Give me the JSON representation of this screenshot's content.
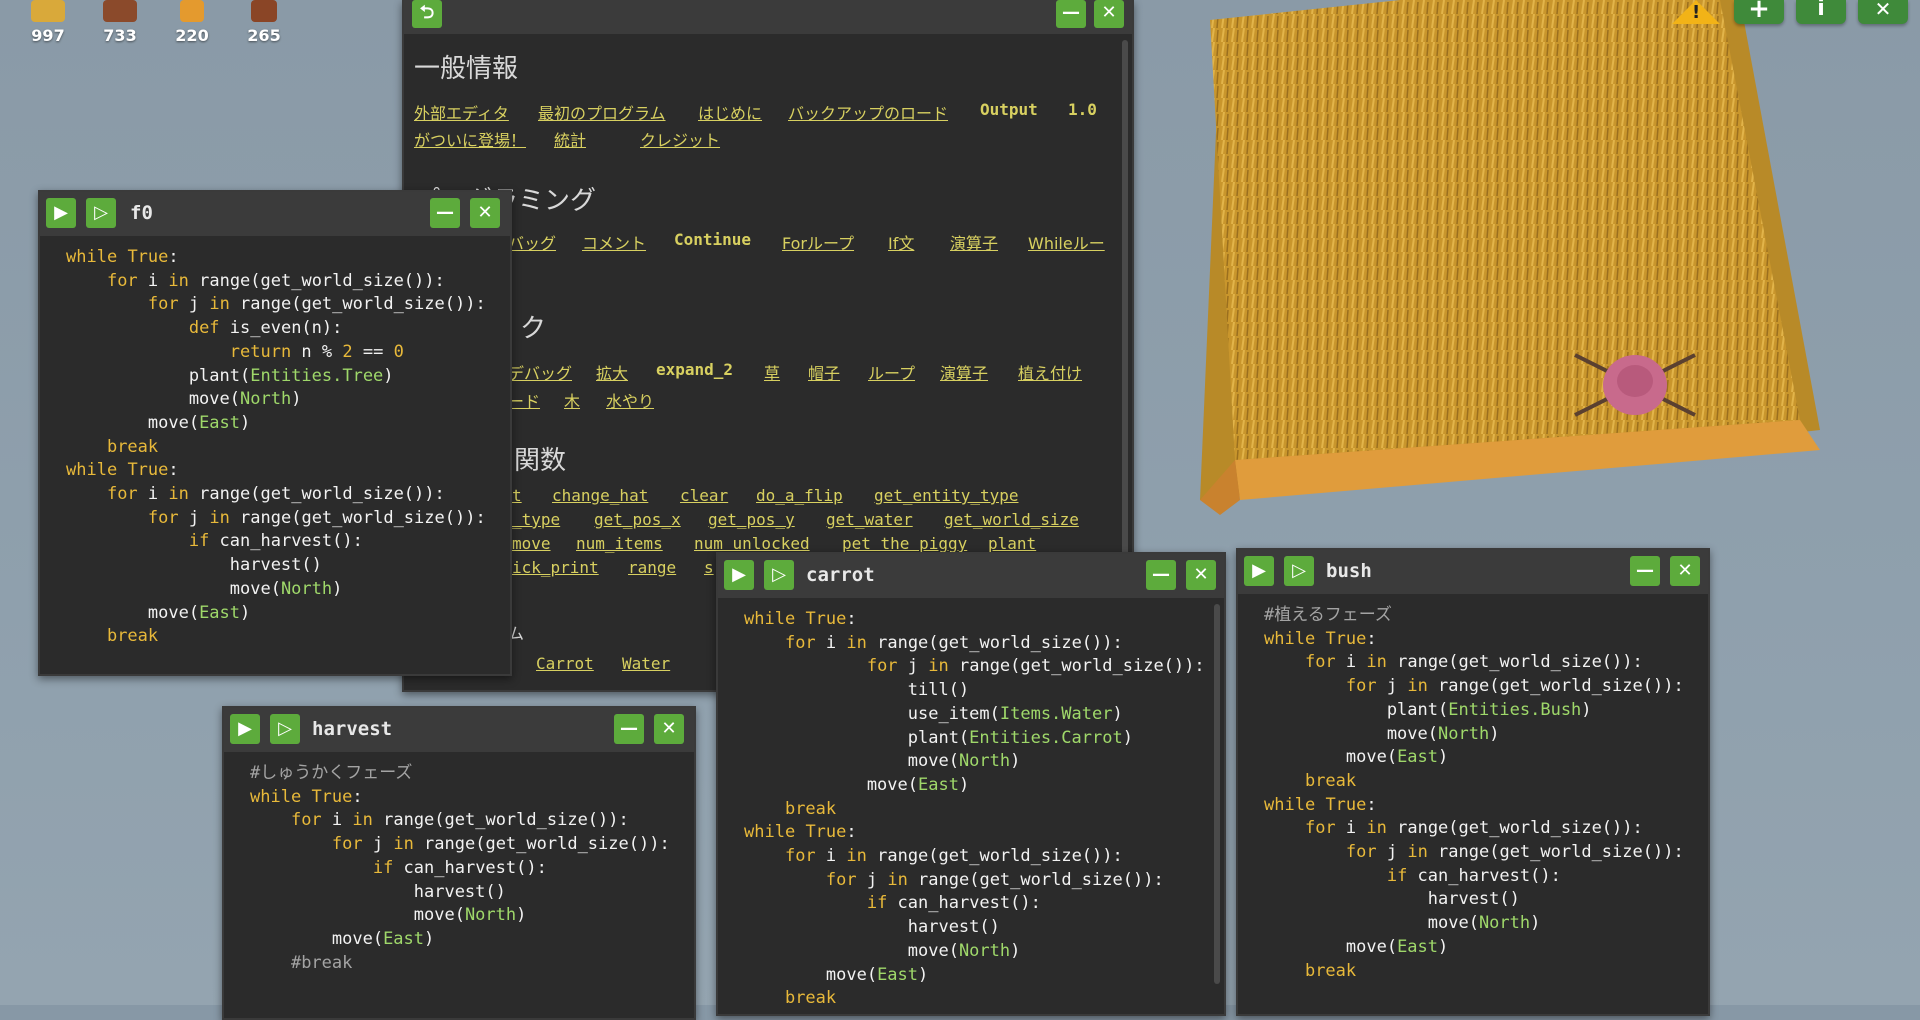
{
  "resources": [
    {
      "icon": "hay-icon",
      "value": "997",
      "color": "#d9a93a"
    },
    {
      "icon": "wood-icon",
      "value": "733",
      "color": "#8b4a2b"
    },
    {
      "icon": "carrot-icon",
      "value": "220",
      "color": "#e49a2e"
    },
    {
      "icon": "pumpkin-icon",
      "value": "265",
      "color": "#8a4526"
    }
  ],
  "top_right": {
    "add_label": "+",
    "info_label": "i",
    "close_label": "✕",
    "warning_label": "!"
  },
  "help": {
    "back_label": "⮌",
    "min_label": "—",
    "close_label": "✕",
    "section_general": "一般情報",
    "general_links": [
      "外部エディタ",
      "最初のプログラム",
      "はじめに",
      "バックアップのロード",
      "Output",
      "1.0"
    ],
    "general_links2": [
      "がついに登場！",
      "統計",
      "クレジット"
    ],
    "section_programming": "プログラミング",
    "programming_links": [
      "バッグ",
      "コメント",
      "Continue",
      "Forループ",
      "If文",
      "演算子",
      "Whileルー"
    ],
    "section_tech": "ク",
    "tech_links": [
      "デバッグ",
      "拡大",
      "expand_2",
      "草",
      "帽子",
      "ループ",
      "演算子",
      "植え付け"
    ],
    "tech_links2": [
      "ード",
      "木",
      "水やり"
    ],
    "section_funcs": "関数",
    "func_links": [
      "t",
      "change_hat",
      "clear",
      "do_a_flip",
      "get_entity_type"
    ],
    "func_links2": [
      "_type",
      "get_pos_x",
      "get_pos_y",
      "get_water",
      "get_world_size"
    ],
    "func_links3": [
      "move",
      "num_items",
      "num_unlocked",
      "pet_the_piggy",
      "plant"
    ],
    "func_links4": [
      "ick_print",
      "range",
      "s"
    ],
    "items_links": [
      "Carrot",
      "Water"
    ],
    "items_prefix": "ム"
  },
  "windows": {
    "f0": {
      "title": "f0"
    },
    "harvest": {
      "title": "harvest"
    },
    "carrot": {
      "title": "carrot"
    },
    "bush": {
      "title": "bush"
    }
  },
  "colors": {
    "accent": "#5dab3c",
    "keyword": "#e8b93a",
    "entity": "#9fd86a",
    "link": "#d8d060"
  }
}
